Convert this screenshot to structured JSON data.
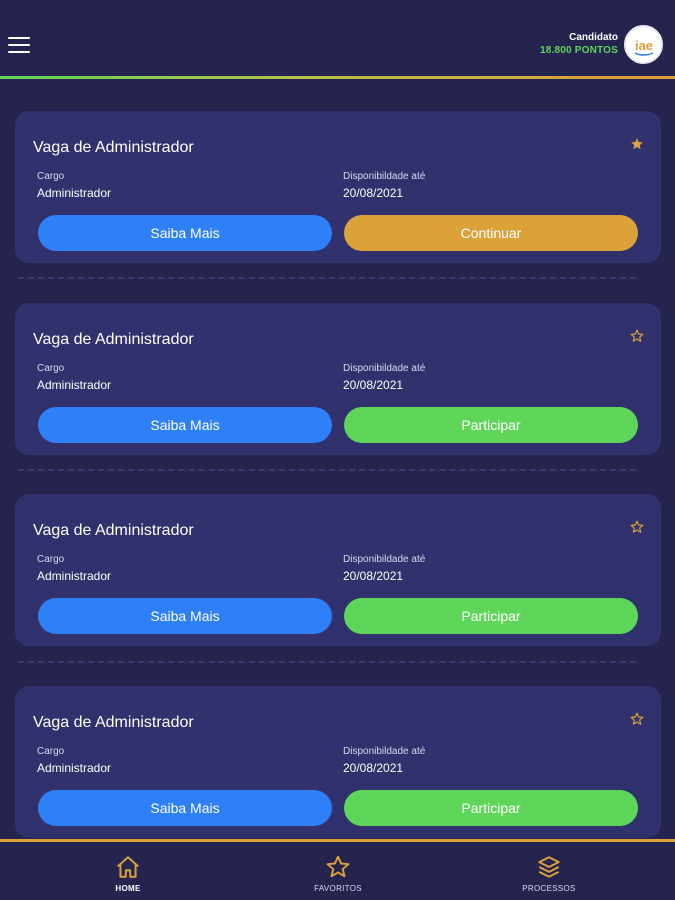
{
  "header": {
    "user_name": "Candidato",
    "user_points": "18.800 PONTOS",
    "avatar_text": "iae"
  },
  "cards": [
    {
      "title": "Vaga de Administrador",
      "cargo_label": "Cargo",
      "cargo_value": "Administrador",
      "disp_label": "Disponibildade até",
      "disp_value": "20/08/2021",
      "btn_info": "Saiba Mais",
      "btn_action": "Continuar",
      "favorited": true
    },
    {
      "title": "Vaga de Administrador",
      "cargo_label": "Cargo",
      "cargo_value": "Administrador",
      "disp_label": "Disponibildade até",
      "disp_value": "20/08/2021",
      "btn_info": "Saiba Mais",
      "btn_action": "Participar",
      "favorited": false
    },
    {
      "title": "Vaga de Administrador",
      "cargo_label": "Cargo",
      "cargo_value": "Administrador",
      "disp_label": "Disponibildade até",
      "disp_value": "20/08/2021",
      "btn_info": "Saiba Mais",
      "btn_action": "Participar",
      "favorited": false
    },
    {
      "title": "Vaga de Administrador",
      "cargo_label": "Cargo",
      "cargo_value": "Administrador",
      "disp_label": "Disponibildade até",
      "disp_value": "20/08/2021",
      "btn_info": "Saiba Mais",
      "btn_action": "Participar",
      "favorited": false
    }
  ],
  "nav": {
    "home": "HOME",
    "favoritos": "FAVORITOS",
    "processos": "PROCESSOS"
  },
  "icons": {
    "menu": "hamburger-menu-icon",
    "favorite": "star-icon",
    "home": "home-icon",
    "favoritos": "star-outline-icon",
    "processos": "layers-icon"
  },
  "colors": {
    "background": "#25244f",
    "card": "#31316e",
    "blue_button": "#2f80f7",
    "orange_button": "#dba23a",
    "green_button": "#5fd65a",
    "accent_orange": "#dba23a",
    "accent_green": "#5fd65a"
  }
}
